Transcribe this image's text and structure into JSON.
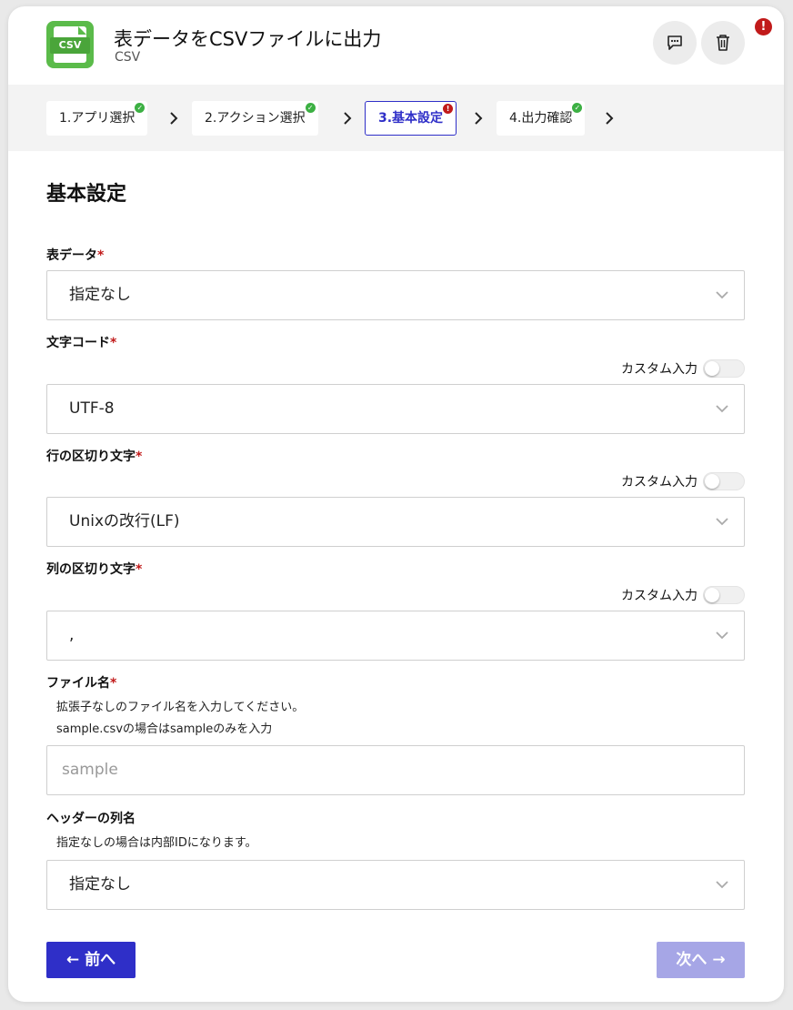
{
  "header": {
    "icon_label": "CSV",
    "title": "表データをCSVファイルに出力",
    "subtitle": "CSV",
    "comment_icon": "comment-icon",
    "delete_icon": "trash-icon",
    "alert_badge": "!"
  },
  "steps": [
    {
      "label": "1.アプリ選択",
      "status": "ok"
    },
    {
      "label": "2.アクション選択",
      "status": "ok"
    },
    {
      "label": "3.基本設定",
      "status": "error",
      "active": true
    },
    {
      "label": "4.出力確認",
      "status": "ok"
    }
  ],
  "form": {
    "section_title": "基本設定",
    "required_mark": "*",
    "table_data": {
      "label": "表データ",
      "value": "指定なし"
    },
    "encoding": {
      "label": "文字コード",
      "custom_label": "カスタム入力",
      "value": "UTF-8"
    },
    "row_delimiter": {
      "label": "行の区切り文字",
      "custom_label": "カスタム入力",
      "value": "Unixの改行(LF)"
    },
    "col_delimiter": {
      "label": "列の区切り文字",
      "custom_label": "カスタム入力",
      "value": ","
    },
    "file_name": {
      "label": "ファイル名",
      "hint1": "拡張子なしのファイル名を入力してください。",
      "hint2": "sample.csvの場合はsampleのみを入力",
      "placeholder": "sample",
      "value": ""
    },
    "header_names": {
      "label": "ヘッダーの列名",
      "hint": "指定なしの場合は内部IDになります。",
      "value": "指定なし"
    }
  },
  "footer": {
    "prev_label": "← 前へ",
    "next_label": "次へ →"
  },
  "colors": {
    "accent": "#2f2fc8",
    "accent_disabled": "#a6a6e6",
    "success": "#3cb043",
    "error": "#c11a1a",
    "app_icon": "#5bbb4a"
  }
}
